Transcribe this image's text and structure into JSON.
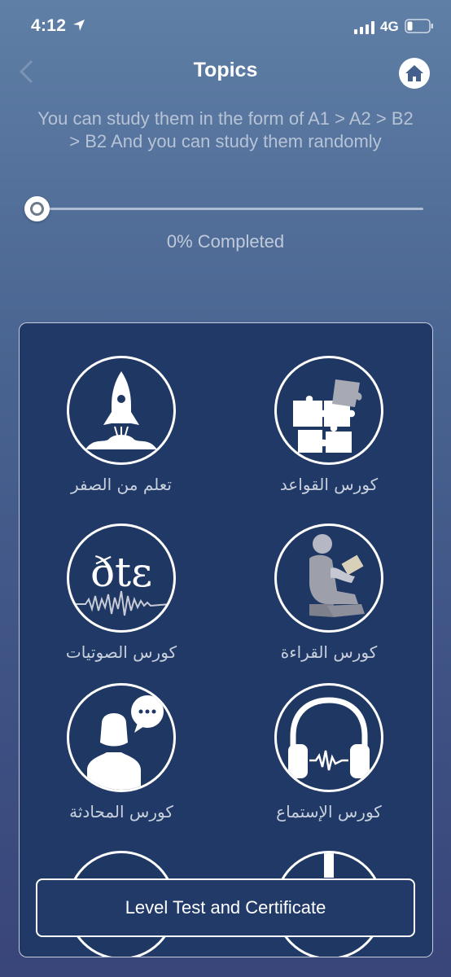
{
  "status_bar": {
    "time": "4:12",
    "network": "4G"
  },
  "nav": {
    "title": "Topics"
  },
  "intro": {
    "text": "You can study them in the form of A1 > A2 > B2 > B2 And you can study them randomly"
  },
  "progress": {
    "value_percent": 0,
    "label": "0% Completed"
  },
  "topics": [
    {
      "label": "تعلم من الصفر",
      "icon": "rocket-icon"
    },
    {
      "label": "كورس القواعد",
      "icon": "puzzle-icon"
    },
    {
      "label": "كورس الصوتيات",
      "icon": "phonetics-icon"
    },
    {
      "label": "كورس القراءة",
      "icon": "reading-person-icon"
    },
    {
      "label": "كورس المحادثة",
      "icon": "conversation-icon"
    },
    {
      "label": "كورس الإستماع",
      "icon": "headphones-icon"
    }
  ],
  "level_test_button": {
    "label": "Level Test and Certificate"
  },
  "colors": {
    "card_bg": "#213966",
    "accent": "#ffffff"
  }
}
